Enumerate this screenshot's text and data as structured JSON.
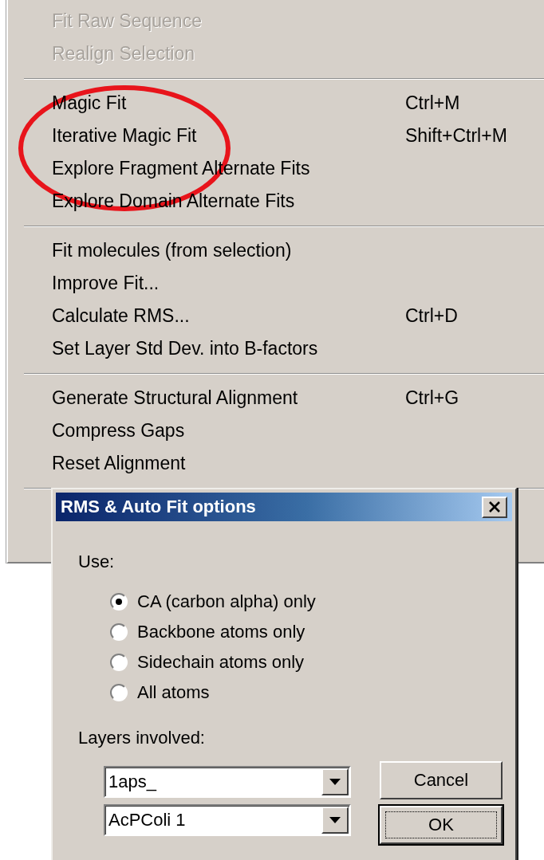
{
  "menu": {
    "groups": [
      {
        "items": [
          {
            "label": "Fit Raw Sequence",
            "disabled": true
          },
          {
            "label": "Realign Selection",
            "disabled": true
          }
        ]
      },
      {
        "items": [
          {
            "label": "Magic Fit",
            "shortcut": "Ctrl+M",
            "disabled": false
          },
          {
            "label": "Iterative Magic Fit",
            "shortcut": "Shift+Ctrl+M",
            "disabled": false
          },
          {
            "label": "Explore Fragment Alternate Fits",
            "disabled": false
          },
          {
            "label": "Explore Domain Alternate Fits",
            "disabled": false
          }
        ]
      },
      {
        "items": [
          {
            "label": "Fit molecules (from selection)",
            "disabled": false
          },
          {
            "label": "Improve Fit...",
            "disabled": false
          },
          {
            "label": "Calculate RMS...",
            "shortcut": "Ctrl+D",
            "disabled": false
          },
          {
            "label": "Set Layer Std Dev. into B-factors",
            "disabled": false
          }
        ]
      },
      {
        "items": [
          {
            "label": "Generate Structural Alignment",
            "shortcut": "Ctrl+G",
            "disabled": false
          },
          {
            "label": "Compress Gaps",
            "disabled": false
          },
          {
            "label": "Reset Alignment",
            "disabled": false
          }
        ]
      }
    ]
  },
  "annotation": {
    "kind": "ring"
  },
  "dialog": {
    "title": "RMS & Auto Fit options",
    "use_label": "Use:",
    "options": [
      {
        "label": "CA (carbon alpha) only",
        "selected": true
      },
      {
        "label": "Backbone atoms only",
        "selected": false
      },
      {
        "label": "Sidechain atoms only",
        "selected": false
      },
      {
        "label": "All atoms",
        "selected": false
      }
    ],
    "layers_label": "Layers involved:",
    "layers": [
      {
        "value": "1aps_"
      },
      {
        "value": "AcPColi 1"
      }
    ],
    "buttons": [
      {
        "label": "Cancel",
        "default": false
      },
      {
        "label": "OK",
        "default": true
      }
    ]
  }
}
